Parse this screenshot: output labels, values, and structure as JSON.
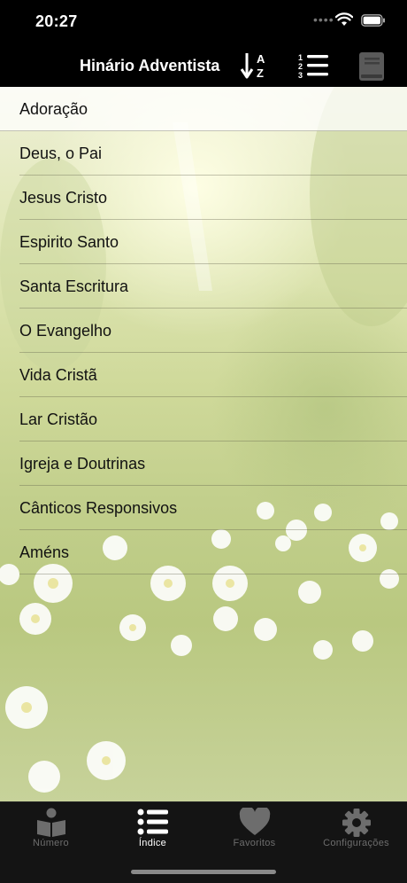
{
  "status_bar": {
    "time": "20:27"
  },
  "header": {
    "title": "Hinário Adventista"
  },
  "nav_actions": [
    {
      "name": "sort-alpha-button",
      "icon": "sort-alpha-icon"
    },
    {
      "name": "sort-numeric-button",
      "icon": "numbered-list-icon"
    },
    {
      "name": "book-button",
      "icon": "book-icon"
    }
  ],
  "categories": [
    "Adoração",
    "Deus, o Pai",
    "Jesus Cristo",
    "Espirito Santo",
    "Santa Escritura",
    "O Evangelho",
    "Vida Cristã",
    "Lar Cristão",
    "Igreja e Doutrinas",
    "Cânticos Responsivos",
    "Améns"
  ],
  "tabs": [
    {
      "label": "Número",
      "icon": "open-book-reader-icon",
      "active": false
    },
    {
      "label": "Índice",
      "icon": "list-icon",
      "active": true
    },
    {
      "label": "Favoritos",
      "icon": "heart-icon",
      "active": false
    },
    {
      "label": "Configurações",
      "icon": "gear-icon",
      "active": false
    }
  ],
  "colors": {
    "bar_background": "#000000",
    "tab_active": "#ffffff",
    "tab_inactive": "#6d6d6d"
  }
}
